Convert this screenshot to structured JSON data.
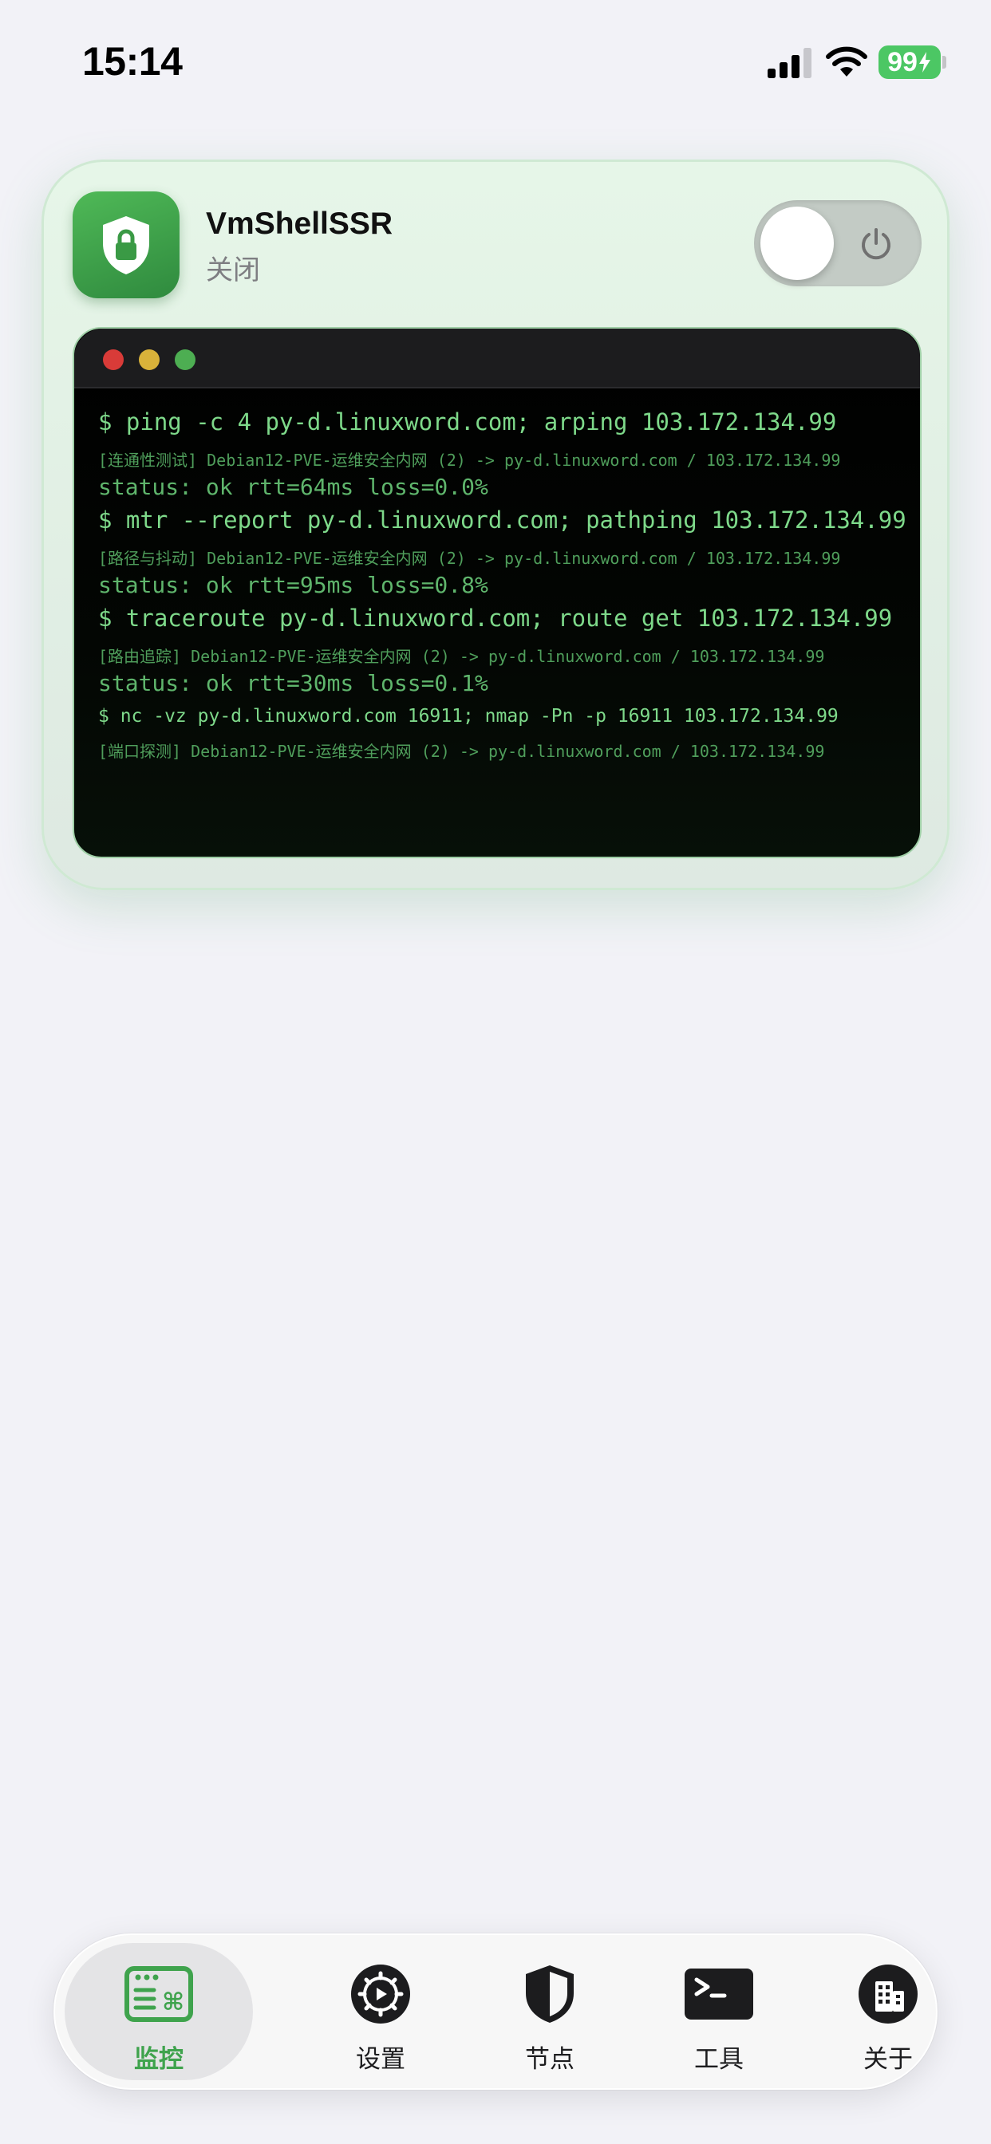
{
  "status_bar": {
    "time": "15:14",
    "battery": "99",
    "icons": [
      "signal-icon",
      "wifi-icon",
      "battery-charging-icon"
    ]
  },
  "vpn_card": {
    "app_name": "VmShellSSR",
    "connection_status": "关闭",
    "toggle_state": "off",
    "icon": "shield-lock-icon"
  },
  "terminal": {
    "lines": [
      {
        "type": "cmd",
        "text": "$ ping -c 4 py-d.linuxword.com; arping 103.172.134.99"
      },
      {
        "type": "meta",
        "text": "[连通性测试] Debian12-PVE-运维安全内网 (2) -> py-d.linuxword.com / 103.172.134.99"
      },
      {
        "type": "stat",
        "text": "status: ok  rtt=64ms  loss=0.0%"
      },
      {
        "type": "cmd",
        "text": "$ mtr --report py-d.linuxword.com; pathping 103.172.134.99"
      },
      {
        "type": "meta",
        "text": "[路径与抖动] Debian12-PVE-运维安全内网 (2) -> py-d.linuxword.com / 103.172.134.99"
      },
      {
        "type": "stat",
        "text": "status: ok  rtt=95ms  loss=0.8%"
      },
      {
        "type": "cmd",
        "text": "$ traceroute py-d.linuxword.com; route get 103.172.134.99"
      },
      {
        "type": "meta",
        "text": "[路由追踪] Debian12-PVE-运维安全内网 (2) -> py-d.linuxword.com / 103.172.134.99"
      },
      {
        "type": "stat",
        "text": "status: ok  rtt=30ms  loss=0.1%"
      },
      {
        "type": "cmd-small",
        "text": "$ nc -vz py-d.linuxword.com 16911; nmap -Pn -p 16911 103.172.134.99"
      },
      {
        "type": "meta",
        "text": "[端口探测] Debian12-PVE-运维安全内网 (2) -> py-d.linuxword.com / 103.172.134.99"
      }
    ]
  },
  "tab_bar": {
    "tabs": [
      {
        "label": "监控",
        "icon": "monitor-dashboard-icon",
        "active": true
      },
      {
        "label": "设置",
        "icon": "gear-icon",
        "active": false
      },
      {
        "label": "节点",
        "icon": "shield-icon",
        "active": false
      },
      {
        "label": "工具",
        "icon": "terminal-icon",
        "active": false
      },
      {
        "label": "关于",
        "icon": "building-icon",
        "active": false
      }
    ]
  },
  "colors": {
    "accent_green": "#3fa34d",
    "terminal_green": "#7ed98a",
    "battery_green": "#4cc764"
  }
}
